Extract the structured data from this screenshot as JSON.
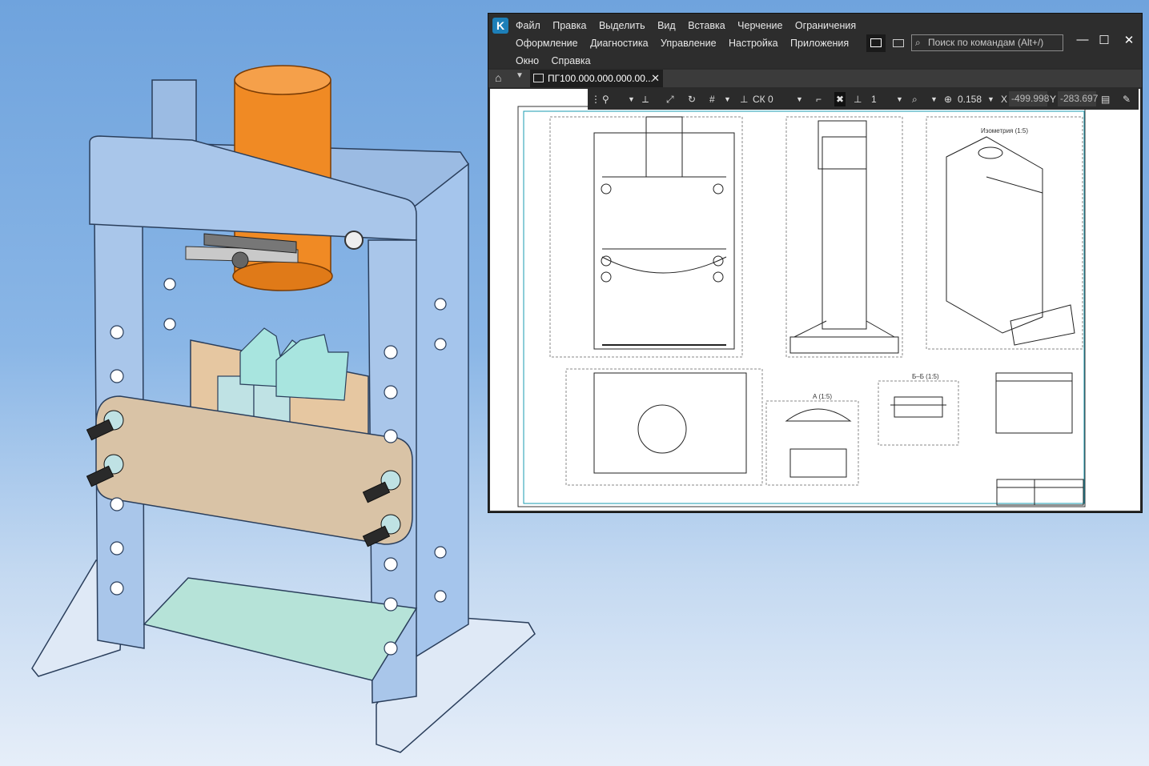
{
  "menu": {
    "row1": [
      "Файл",
      "Правка",
      "Выделить",
      "Вид",
      "Вставка",
      "Черчение",
      "Ограничения"
    ],
    "row2": [
      "Оформление",
      "Диагностика",
      "Управление",
      "Настройка",
      "Приложения"
    ],
    "row3": [
      "Окно",
      "Справка"
    ]
  },
  "search": {
    "placeholder": "Поиск по командам (Alt+/)"
  },
  "window_controls": {
    "minimize": "—",
    "maximize": "☐",
    "close": "✕"
  },
  "tabs": [
    {
      "label": "ПГ100.000.000.000.00..."
    }
  ],
  "toolbar": {
    "cs_label": "СК 0",
    "layer_value": "1",
    "zoom_value": "0.158",
    "x_label": "X",
    "x_value": "-499.998",
    "y_label": "Y",
    "y_value": "-283.697"
  },
  "drawing": {
    "view_iso_title": "Изометрия (1:5)",
    "view_a_title": "А (1:5)",
    "view_section_title": "Б–Б (1:5)"
  },
  "colors": {
    "frame": "#a9c6ea",
    "cylinder": "#f08a24",
    "plate": "#d9c3a6",
    "blocks": "#a8e5df",
    "floor": "#b6e3d8",
    "ui_bg": "#2b2b2b"
  }
}
